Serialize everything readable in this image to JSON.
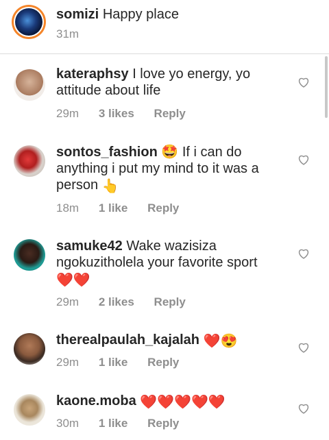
{
  "post": {
    "username": "somizi",
    "caption": "Happy place",
    "time": "31m"
  },
  "comments": [
    {
      "username": "kateraphsy",
      "text": "I love yo energy, yo attitude about life",
      "time": "29m",
      "likes": "3 likes",
      "reply": "Reply",
      "avatar_color": "#c9a08a"
    },
    {
      "username": "sontos_fashion",
      "text_a": "🤩 If i can do anything i put my mind to it was a person",
      "text_b": "👆",
      "time": "18m",
      "likes": "1 like",
      "reply": "Reply",
      "avatar_color": "#e23a3a"
    },
    {
      "username": "samuke42",
      "text": "Wake wazisiza ngokuzitholela your favorite sport",
      "emojis": "❤️❤️",
      "time": "29m",
      "likes": "2 likes",
      "reply": "Reply",
      "avatar_color": "#1f8f8a"
    },
    {
      "username": "therealpaulah_kajalah",
      "emojis": "❤️😍",
      "time": "29m",
      "likes": "1 like",
      "reply": "Reply",
      "avatar_color": "#9b6a50"
    },
    {
      "username": "kaone.moba",
      "emojis": "❤️❤️❤️❤️❤️",
      "time": "30m",
      "likes": "1 like",
      "reply": "Reply",
      "avatar_color": "#d8c9a8"
    }
  ],
  "colors": {
    "text": "#262626",
    "secondary": "#8e8e8e",
    "heart": "#e0245e",
    "divider": "#dbdbdb"
  },
  "icons": {
    "like": "heart-outline-icon"
  }
}
